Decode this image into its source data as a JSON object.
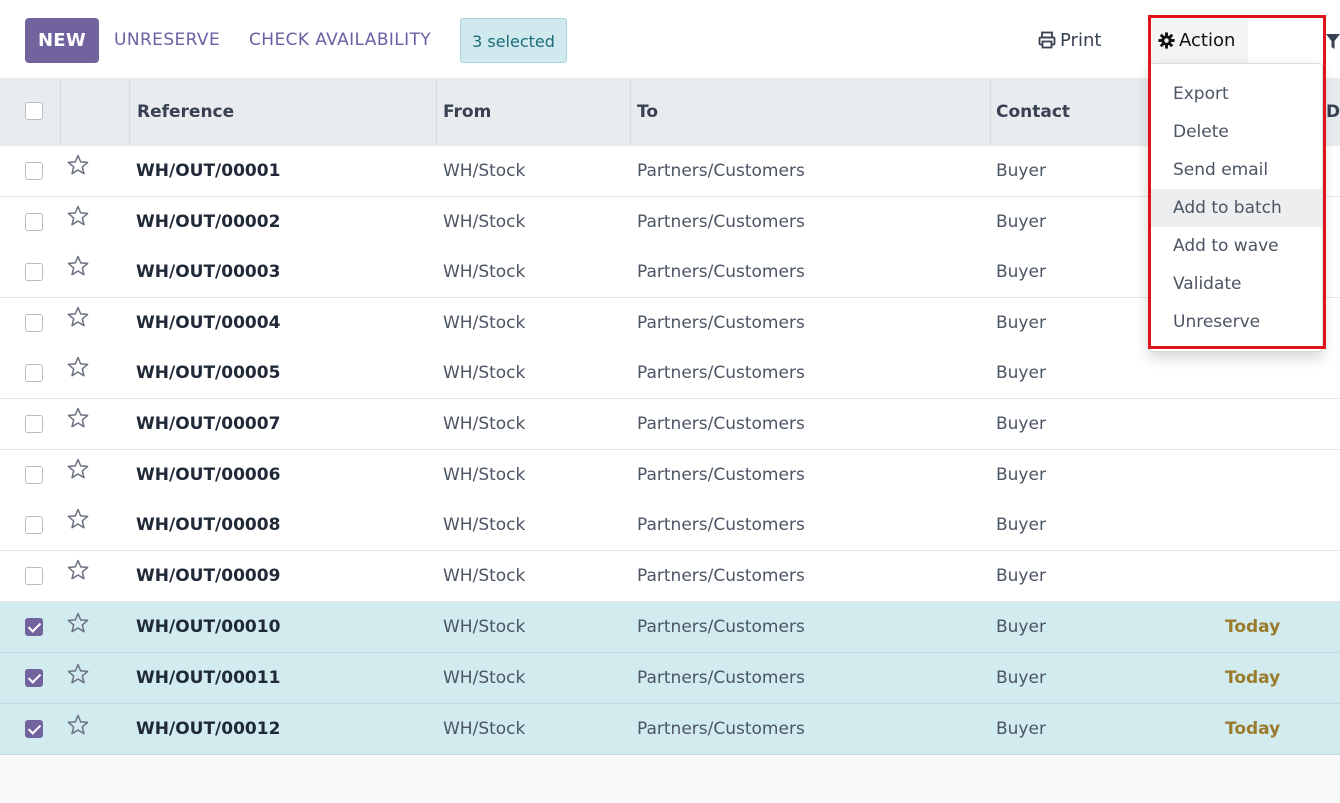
{
  "toolbar": {
    "new_label": "NEW",
    "unreserve_label": "UNRESERVE",
    "check_label": "CHECK AVAILABILITY",
    "selected_label": "3 selected",
    "print_label": "Print",
    "action_label": "Action"
  },
  "columns": {
    "reference": "Reference",
    "from": "From",
    "to": "To",
    "contact": "Contact",
    "date": "Da"
  },
  "rows": [
    {
      "ref": "WH/OUT/00001",
      "from": "WH/Stock",
      "to": "Partners/Customers",
      "contact": "Buyer",
      "date": "",
      "selected": false
    },
    {
      "ref": "WH/OUT/00002",
      "from": "WH/Stock",
      "to": "Partners/Customers",
      "contact": "Buyer",
      "date": "",
      "selected": false
    },
    {
      "ref": "WH/OUT/00003",
      "from": "WH/Stock",
      "to": "Partners/Customers",
      "contact": "Buyer",
      "date": "",
      "selected": false
    },
    {
      "ref": "WH/OUT/00004",
      "from": "WH/Stock",
      "to": "Partners/Customers",
      "contact": "Buyer",
      "date": "",
      "selected": false
    },
    {
      "ref": "WH/OUT/00005",
      "from": "WH/Stock",
      "to": "Partners/Customers",
      "contact": "Buyer",
      "date": "",
      "selected": false
    },
    {
      "ref": "WH/OUT/00007",
      "from": "WH/Stock",
      "to": "Partners/Customers",
      "contact": "Buyer",
      "date": "",
      "selected": false
    },
    {
      "ref": "WH/OUT/00006",
      "from": "WH/Stock",
      "to": "Partners/Customers",
      "contact": "Buyer",
      "date": "",
      "selected": false
    },
    {
      "ref": "WH/OUT/00008",
      "from": "WH/Stock",
      "to": "Partners/Customers",
      "contact": "Buyer",
      "date": "",
      "selected": false
    },
    {
      "ref": "WH/OUT/00009",
      "from": "WH/Stock",
      "to": "Partners/Customers",
      "contact": "Buyer",
      "date": "",
      "selected": false
    },
    {
      "ref": "WH/OUT/00010",
      "from": "WH/Stock",
      "to": "Partners/Customers",
      "contact": "Buyer",
      "date": "Today",
      "selected": true
    },
    {
      "ref": "WH/OUT/00011",
      "from": "WH/Stock",
      "to": "Partners/Customers",
      "contact": "Buyer",
      "date": "Today",
      "selected": true
    },
    {
      "ref": "WH/OUT/00012",
      "from": "WH/Stock",
      "to": "Partners/Customers",
      "contact": "Buyer",
      "date": "Today",
      "selected": true
    }
  ],
  "action_menu": {
    "items": [
      "Export",
      "Delete",
      "Send email",
      "Add to batch",
      "Add to wave",
      "Validate",
      "Unreserve"
    ],
    "hovered": "Add to batch"
  },
  "colors": {
    "primary": "#71639e",
    "selected_row": "#d1ebef",
    "highlight_box": "#e0141a",
    "date_today": "#9a7b2c"
  }
}
